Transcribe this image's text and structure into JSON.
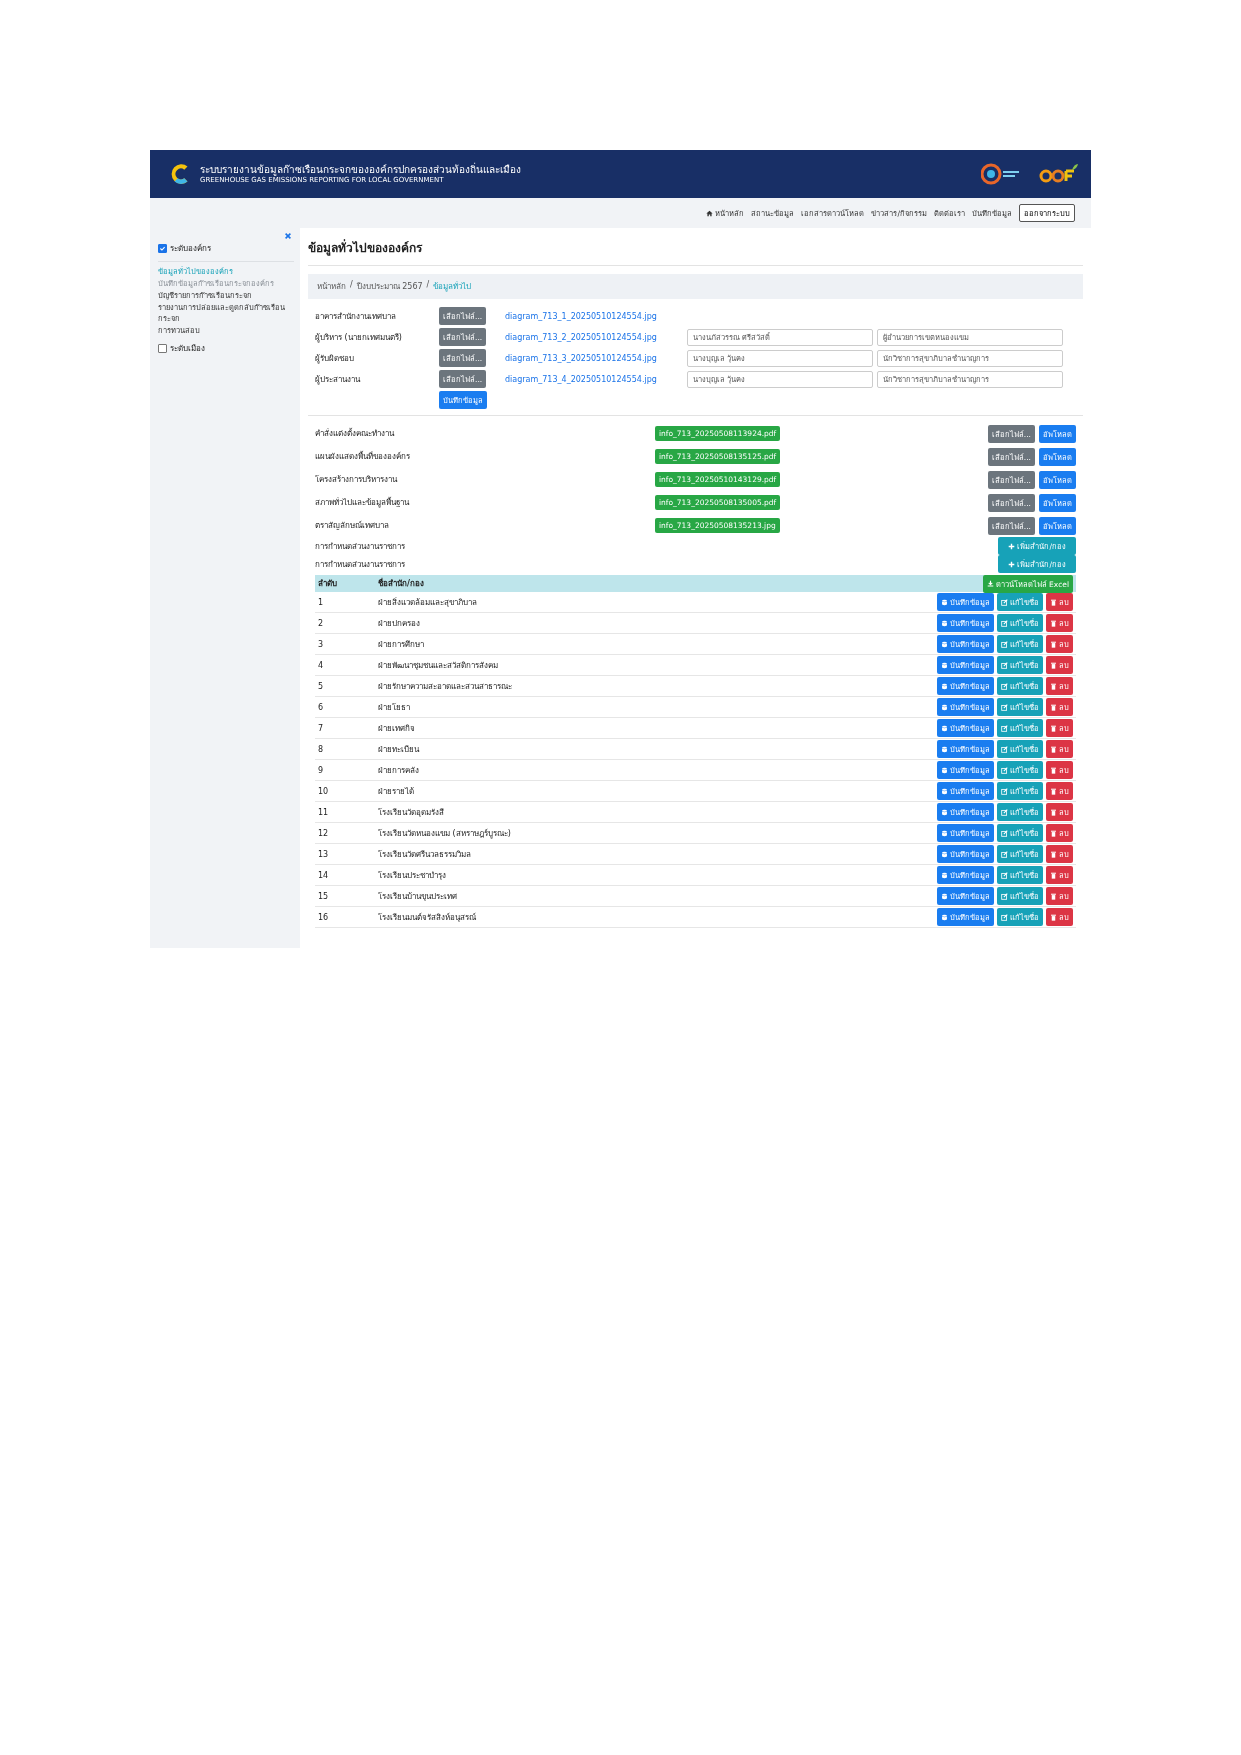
{
  "header": {
    "title": "ระบบรายงานข้อมูลก๊าซเรือนกระจกขององค์กรปกครองส่วนท้องถิ่นและเมือง",
    "subtitle": "GREENHOUSE GAS EMISSIONS REPORTING FOR LOCAL GOVERNMENT"
  },
  "nav": {
    "items": [
      {
        "label": "หน้าหลัก",
        "kind": "home"
      },
      {
        "label": "สถานะข้อมูล",
        "kind": "plain"
      },
      {
        "label": "เอกสารดาวน์โหลด",
        "kind": "plain"
      },
      {
        "label": "ข่าวสาร/กิจกรรม",
        "kind": "plain"
      },
      {
        "label": "ติดต่อเรา",
        "kind": "plain"
      },
      {
        "label": "บันทึกข้อมูล",
        "kind": "plain"
      }
    ],
    "logout": "ออกจากระบบ"
  },
  "sidebar": {
    "groups": [
      {
        "label": "ระดับองค์กร",
        "checked": true,
        "links": [
          {
            "label": "ข้อมูลทั่วไปขององค์กร",
            "selected": true,
            "disabled": false
          },
          {
            "label": "บันทึกข้อมูลก๊าซเรือนกระจกองค์กร",
            "selected": false,
            "disabled": true
          },
          {
            "label": "บัญชีรายการก๊าซเรือนกระจก",
            "selected": false,
            "disabled": false
          },
          {
            "label": "รายงานการปล่อยและดูดกลับก๊าซเรือนกระจก",
            "selected": false,
            "disabled": false
          },
          {
            "label": "การทวนสอบ",
            "selected": false,
            "disabled": false
          }
        ]
      },
      {
        "label": "ระดับเมือง",
        "checked": false
      }
    ]
  },
  "page_title": "ข้อมูลทั่วไปขององค์กร",
  "breadcrumb": [
    {
      "label": "หน้าหลัก",
      "selected": false
    },
    {
      "separator": "/",
      "label": "ปีงบประมาณ 2567",
      "selected": false
    },
    {
      "separator": "/",
      "label": "ข้อมูลทั่วไป",
      "selected": true
    }
  ],
  "photos": {
    "rows": [
      {
        "label": "อาคารสำนักงานเทศบาล",
        "button": "เลือกไฟล์...",
        "file": "diagram_713_1_20250510124554.jpg"
      },
      {
        "label": "ผู้บริหาร (นายกเทศมนตรี)",
        "button": "เลือกไฟล์...",
        "file": "diagram_713_2_20250510124554.jpg",
        "name": "นางนภัสวรรณ ศรีสวัสดิ์",
        "position": "ผู้อำนวยการเขตหนองแขม"
      },
      {
        "label": "ผู้รับผิดชอบ",
        "button": "เลือกไฟล์...",
        "file": "diagram_713_3_20250510124554.jpg",
        "name": "นางบุญเล วุ้นคง",
        "position": "นักวิชาการสุขาภิบาลชำนาญการ"
      },
      {
        "label": "ผู้ประสานงาน",
        "button": "เลือกไฟล์...",
        "file": "diagram_713_4_20250510124554.jpg",
        "name": "นางบุญเล วุ้นคง",
        "position": "นักวิชาการสุขาภิบาลชำนาญการ"
      }
    ],
    "save_button": "บันทึกข้อมูล"
  },
  "documents": [
    {
      "label": "คำสั่งแต่งตั้งคณะทำงาน",
      "file": "info_713_20250508113924.pdf",
      "choose_button": "เลือกไฟล์...",
      "upload_button": "อัพโหลด"
    },
    {
      "label": "แผนผังแสดงพื้นที่ขององค์กร",
      "file": "info_713_20250508135125.pdf",
      "choose_button": "เลือกไฟล์...",
      "upload_button": "อัพโหลด"
    },
    {
      "label": "โครงสร้างการบริหารงาน",
      "file": "info_713_20250510143129.pdf",
      "choose_button": "เลือกไฟล์...",
      "upload_button": "อัพโหลด"
    },
    {
      "label": "สภาพทั่วไปและข้อมูลพื้นฐาน",
      "file": "info_713_20250508135005.pdf",
      "choose_button": "เลือกไฟล์...",
      "upload_button": "อัพโหลด"
    },
    {
      "label": "ตราสัญลักษณ์เทศบาล",
      "file": "info_713_20250508135213.jpg",
      "choose_button": "เลือกไฟล์...",
      "upload_button": "อัพโหลด"
    }
  ],
  "divisions": [
    {
      "label": "การกำหนดส่วนงานราชการ",
      "button": "เพิ่มสำนัก/กอง"
    },
    {
      "label": "การกำหนดส่วนงานราชการ",
      "button": "เพิ่มสำนัก/กอง"
    }
  ],
  "table": {
    "columns": [
      "ลำดับ",
      "ชื่อสำนัก/กอง"
    ],
    "export_button": "ดาวน์โหลดไฟล์ Excel",
    "rows": [
      {
        "number": "1",
        "name": "ฝ่ายสิ่งแวดล้อมและสุขาภิบาล",
        "actions": [
          {
            "kind": "save",
            "label": "บันทึกข้อมูล"
          },
          {
            "kind": "edit",
            "label": "แก้ไขชื่อ"
          },
          {
            "kind": "delete",
            "label": "ลบ"
          }
        ]
      },
      {
        "number": "2",
        "name": "ฝ่ายปกครอง",
        "actions": [
          {
            "kind": "save",
            "label": "บันทึกข้อมูล"
          },
          {
            "kind": "edit",
            "label": "แก้ไขชื่อ"
          },
          {
            "kind": "delete",
            "label": "ลบ"
          }
        ]
      },
      {
        "number": "3",
        "name": "ฝ่ายการศึกษา",
        "actions": [
          {
            "kind": "save",
            "label": "บันทึกข้อมูล"
          },
          {
            "kind": "edit",
            "label": "แก้ไขชื่อ"
          },
          {
            "kind": "delete",
            "label": "ลบ"
          }
        ]
      },
      {
        "number": "4",
        "name": "ฝ่ายพัฒนาชุมชนและสวัสดิการสังคม",
        "actions": [
          {
            "kind": "save",
            "label": "บันทึกข้อมูล"
          },
          {
            "kind": "edit",
            "label": "แก้ไขชื่อ"
          },
          {
            "kind": "delete",
            "label": "ลบ"
          }
        ]
      },
      {
        "number": "5",
        "name": "ฝ่ายรักษาความสะอาดและสวนสาธารณะ",
        "actions": [
          {
            "kind": "save",
            "label": "บันทึกข้อมูล"
          },
          {
            "kind": "edit",
            "label": "แก้ไขชื่อ"
          },
          {
            "kind": "delete",
            "label": "ลบ"
          }
        ]
      },
      {
        "number": "6",
        "name": "ฝ่ายโยธา",
        "actions": [
          {
            "kind": "save",
            "label": "บันทึกข้อมูล"
          },
          {
            "kind": "edit",
            "label": "แก้ไขชื่อ"
          },
          {
            "kind": "delete",
            "label": "ลบ"
          }
        ]
      },
      {
        "number": "7",
        "name": "ฝ่ายเทศกิจ",
        "actions": [
          {
            "kind": "save",
            "label": "บันทึกข้อมูล"
          },
          {
            "kind": "edit",
            "label": "แก้ไขชื่อ"
          },
          {
            "kind": "delete",
            "label": "ลบ"
          }
        ]
      },
      {
        "number": "8",
        "name": "ฝ่ายทะเบียน",
        "actions": [
          {
            "kind": "save",
            "label": "บันทึกข้อมูล"
          },
          {
            "kind": "edit",
            "label": "แก้ไขชื่อ"
          },
          {
            "kind": "delete",
            "label": "ลบ"
          }
        ]
      },
      {
        "number": "9",
        "name": "ฝ่ายการคลัง",
        "actions": [
          {
            "kind": "save",
            "label": "บันทึกข้อมูล"
          },
          {
            "kind": "edit",
            "label": "แก้ไขชื่อ"
          },
          {
            "kind": "delete",
            "label": "ลบ"
          }
        ]
      },
      {
        "number": "10",
        "name": "ฝ่ายรายได้",
        "actions": [
          {
            "kind": "save",
            "label": "บันทึกข้อมูล"
          },
          {
            "kind": "edit",
            "label": "แก้ไขชื่อ"
          },
          {
            "kind": "delete",
            "label": "ลบ"
          }
        ]
      },
      {
        "number": "11",
        "name": "โรงเรียนวัดอุดมรังสี",
        "actions": [
          {
            "kind": "save",
            "label": "บันทึกข้อมูล"
          },
          {
            "kind": "edit",
            "label": "แก้ไขชื่อ"
          },
          {
            "kind": "delete",
            "label": "ลบ"
          }
        ]
      },
      {
        "number": "12",
        "name": "โรงเรียนวัดหนองแขม (สหราษฎร์บูรณะ)",
        "actions": [
          {
            "kind": "save",
            "label": "บันทึกข้อมูล"
          },
          {
            "kind": "edit",
            "label": "แก้ไขชื่อ"
          },
          {
            "kind": "delete",
            "label": "ลบ"
          }
        ]
      },
      {
        "number": "13",
        "name": "โรงเรียนวัดศรีนวลธรรมวิมล",
        "actions": [
          {
            "kind": "save",
            "label": "บันทึกข้อมูล"
          },
          {
            "kind": "edit",
            "label": "แก้ไขชื่อ"
          },
          {
            "kind": "delete",
            "label": "ลบ"
          }
        ]
      },
      {
        "number": "14",
        "name": "โรงเรียนประชาบำรุง",
        "actions": [
          {
            "kind": "save",
            "label": "บันทึกข้อมูล"
          },
          {
            "kind": "edit",
            "label": "แก้ไขชื่อ"
          },
          {
            "kind": "delete",
            "label": "ลบ"
          }
        ]
      },
      {
        "number": "15",
        "name": "โรงเรียนบ้านขุนประเทศ",
        "actions": [
          {
            "kind": "save",
            "label": "บันทึกข้อมูล"
          },
          {
            "kind": "edit",
            "label": "แก้ไขชื่อ"
          },
          {
            "kind": "delete",
            "label": "ลบ"
          }
        ]
      },
      {
        "number": "16",
        "name": "โรงเรียนมนต์จรัสสิงห์อนุสรณ์",
        "actions": [
          {
            "kind": "save",
            "label": "บันทึกข้อมูล"
          },
          {
            "kind": "edit",
            "label": "แก้ไขชื่อ"
          },
          {
            "kind": "delete",
            "label": "ลบ"
          }
        ]
      }
    ]
  }
}
